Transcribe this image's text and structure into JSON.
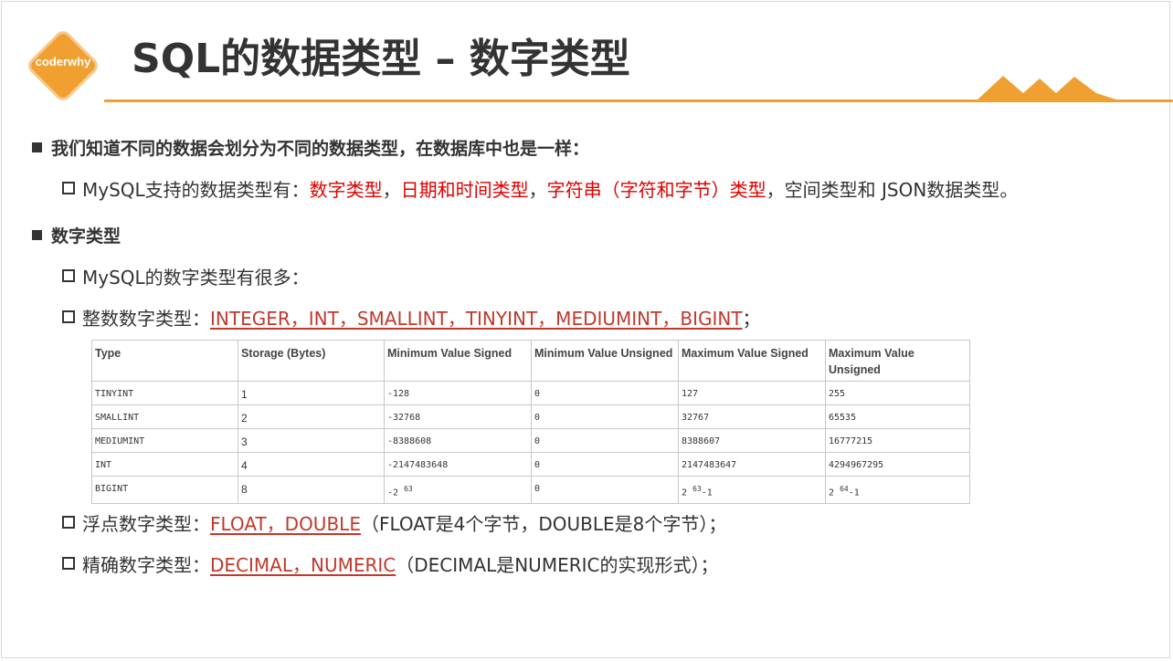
{
  "header": {
    "logo_text": "coderwhy",
    "title": "SQL的数据类型 – 数字类型",
    "accent_color": "#f0a030"
  },
  "section1": {
    "heading": "我们知道不同的数据会划分为不同的数据类型，在数据库中也是一样：",
    "item": {
      "prefix": "MySQL支持的数据类型有：",
      "t1": "数字类型",
      "sep1": "，",
      "t2": "日期和时间类型",
      "sep2": "，",
      "t3": "字符串（字符和字节）类型",
      "suffix": "，空间类型和 JSON数据类型。"
    }
  },
  "section2": {
    "heading": "数字类型",
    "item1": "MySQL的数字类型有很多：",
    "item2": {
      "prefix": "整数数字类型：",
      "link": "INTEGER，INT，SMALLINT，TINYINT，MEDIUMINT，BIGINT",
      "suffix": "；"
    },
    "item3": {
      "prefix": "浮点数字类型：",
      "link": "FLOAT，DOUBLE",
      "suffix": "（FLOAT是4个字节，DOUBLE是8个字节）；"
    },
    "item4": {
      "prefix": "精确数字类型：",
      "link": "DECIMAL，NUMERIC",
      "suffix": "（DECIMAL是NUMERIC的实现形式）；"
    }
  },
  "table": {
    "headers": [
      "Type",
      "Storage (Bytes)",
      "Minimum Value Signed",
      "Minimum Value Unsigned",
      "Maximum Value Signed",
      "Maximum Value Unsigned"
    ],
    "rows": [
      {
        "type": "TINYINT",
        "storage": "1",
        "min_signed": "-128",
        "min_unsigned": "0",
        "max_signed": "127",
        "max_unsigned": "255"
      },
      {
        "type": "SMALLINT",
        "storage": "2",
        "min_signed": "-32768",
        "min_unsigned": "0",
        "max_signed": "32767",
        "max_unsigned": "65535"
      },
      {
        "type": "MEDIUMINT",
        "storage": "3",
        "min_signed": "-8388608",
        "min_unsigned": "0",
        "max_signed": "8388607",
        "max_unsigned": "16777215"
      },
      {
        "type": "INT",
        "storage": "4",
        "min_signed": "-2147483648",
        "min_unsigned": "0",
        "max_signed": "2147483647",
        "max_unsigned": "4294967295"
      },
      {
        "type": "BIGINT",
        "storage": "8",
        "min_signed_base": "-2",
        "min_signed_exp": "63",
        "min_unsigned": "0",
        "max_signed_base": "2",
        "max_signed_exp": "63",
        "max_signed_tail": "-1",
        "max_unsigned_base": "2",
        "max_unsigned_exp": "64",
        "max_unsigned_tail": "-1"
      }
    ]
  }
}
